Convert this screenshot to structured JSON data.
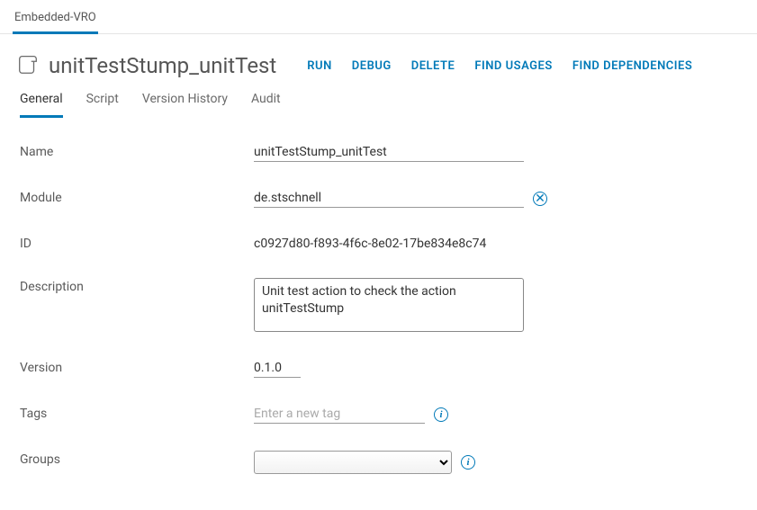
{
  "topTab": "Embedded-VRO",
  "pageTitle": "unitTestStump_unitTest",
  "actions": {
    "run": "RUN",
    "debug": "DEBUG",
    "delete": "DELETE",
    "findUsages": "FIND USAGES",
    "findDependencies": "FIND DEPENDENCIES"
  },
  "tabs": {
    "general": "General",
    "script": "Script",
    "versionHistory": "Version History",
    "audit": "Audit"
  },
  "form": {
    "labels": {
      "name": "Name",
      "module": "Module",
      "id": "ID",
      "description": "Description",
      "version": "Version",
      "tags": "Tags",
      "groups": "Groups"
    },
    "values": {
      "name": "unitTestStump_unitTest",
      "module": "de.stschnell",
      "id": "c0927d80-f893-4f6c-8e02-17be834e8c74",
      "description": "Unit test action to check the action unitTestStump",
      "version": "0.1.0",
      "tags": "",
      "groups": ""
    },
    "placeholders": {
      "tags": "Enter a new tag"
    }
  }
}
